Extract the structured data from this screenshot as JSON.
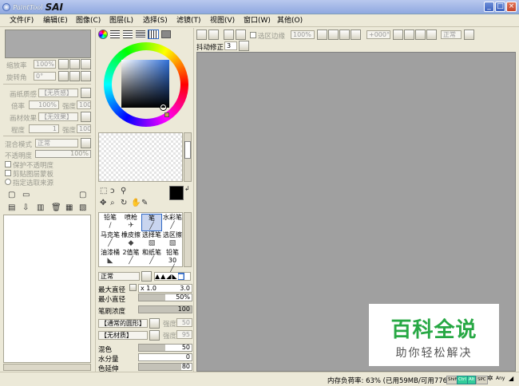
{
  "window": {
    "brand": "PaintTool",
    "name": "SAI",
    "minimize": "_",
    "maximize": "□",
    "close": "×"
  },
  "menu": [
    "文件(F)",
    "编辑(E)",
    "图像(C)",
    "图层(L)",
    "选择(S)",
    "滤镜(T)",
    "视图(V)",
    "窗口(W)",
    "其他(O)"
  ],
  "nav": {
    "zoom_label": "缩放率",
    "zoom_value": "100%",
    "angle_label": "旋转角",
    "angle_value": "0°"
  },
  "layer": {
    "paper_label": "画纸质感",
    "paper_value": "【无质感】",
    "scale_label": "倍率",
    "scale_value": "100%",
    "strength_label": "强度",
    "strength_value": "100",
    "effect_label": "画材效果",
    "effect_value": "【无效果】",
    "degree_label": "程度",
    "degree_value": "1",
    "strength2_label": "强度",
    "strength2_value": "100",
    "blend_label": "混合模式",
    "blend_value": "正常",
    "opacity_label": "不透明度",
    "opacity_value": "100%",
    "preserve_opacity": "保护不透明度",
    "clip_group": "剪贴图层蒙板",
    "selection_source": "指定选取来源"
  },
  "canvas_toolbar": {
    "selection_edge": "选区边缘",
    "zoom": "100%",
    "rotate": "+000°",
    "mode": "正常",
    "stabilizer_label": "抖动修正",
    "stabilizer_value": "3"
  },
  "tools": {
    "row1": [
      "铅笔",
      "喷枪",
      "笔",
      "水彩笔"
    ],
    "row2": [
      "马克笔",
      "橡皮擦",
      "选择笔",
      "选区擦"
    ],
    "row3": [
      "油漆桶",
      "2值笔",
      "和纸笔",
      "铅笔30"
    ]
  },
  "brush": {
    "mode": "正常",
    "max_diameter_label": "最大直径",
    "max_diameter_mult": "x 1.0",
    "max_diameter_value": "3.0",
    "min_diameter_label": "最小直径",
    "min_diameter_value": "50%",
    "min_diameter_fill": 0.5,
    "density_label": "笔刷浓度",
    "density_value": "100",
    "density_fill": 1.0,
    "shape_value": "【通常的圆形】",
    "shape_strength_label": "强度",
    "shape_strength_value": "50",
    "texture_value": "【无材质】",
    "texture_strength_label": "强度",
    "texture_strength_value": "95",
    "blend_label": "混色",
    "blend_value": "50",
    "blend_fill": 0.5,
    "water_label": "水分量",
    "water_value": "0",
    "water_fill": 0.0,
    "persistence_label": "色延伸",
    "persistence_value": "80",
    "persistence_fill": 0.8
  },
  "status": {
    "memory": "内存负荷率: 63% (已用59MB/可用776MB)",
    "keys": [
      "Shift",
      "Ctrl",
      "Alt",
      "SPC"
    ],
    "any": "Any"
  },
  "watermark": {
    "title": "百科全说",
    "subtitle": "助你轻松解决"
  },
  "colors": {
    "canvas": "#a0a0a0",
    "accent": "#316ac5",
    "watermark_green": "#27a844"
  }
}
